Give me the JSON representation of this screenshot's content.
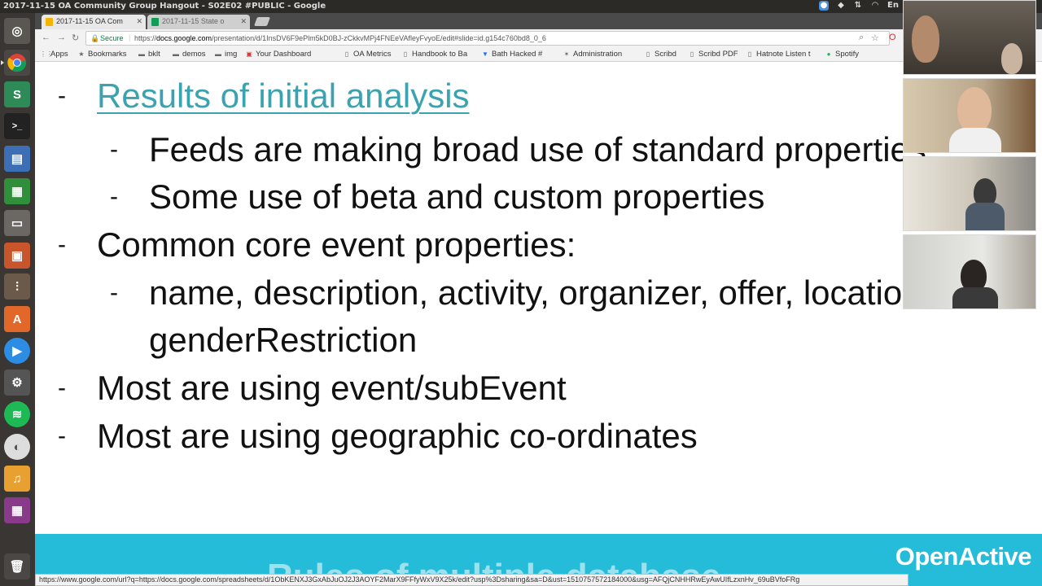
{
  "window_title": "2017-11-15 OA Community Group Hangout - S02E02 #PUBLIC - Google Slides - Goo",
  "tabs": [
    {
      "label": "2017-11-15 OA Com",
      "active": true,
      "favicon_color": "#f4b400"
    },
    {
      "label": "2017-11-15 State o",
      "active": false,
      "favicon_color": "#0f9d58"
    }
  ],
  "omnibox": {
    "secure_label": "Secure",
    "url_prefix": "https://",
    "url_host": "docs.google.com",
    "url_path": "/presentation/d/1InsDV6F9ePlm5kD0BJ-zCkkvMPj4FNEeVAfleyFvyoE/edit#slide=id.g154c760bd8_0_6"
  },
  "bookmarks": [
    {
      "label": "Apps",
      "icon": "apps-grid-icon"
    },
    {
      "label": "Bookmarks",
      "icon": "star-icon"
    },
    {
      "label": "bklt",
      "icon": "folder-icon"
    },
    {
      "label": "demos",
      "icon": "folder-icon"
    },
    {
      "label": "img",
      "icon": "folder-icon"
    },
    {
      "label": "Your Dashboard",
      "icon": "dashboard-icon"
    },
    {
      "label": "OA Metrics",
      "icon": "page-icon"
    },
    {
      "label": "Handbook to Ba",
      "icon": "page-icon"
    },
    {
      "label": "Bath Hacked #",
      "icon": "hacked-icon"
    },
    {
      "label": "Administration",
      "icon": "admin-icon"
    },
    {
      "label": "Scribd",
      "icon": "page-icon"
    },
    {
      "label": "Scribd PDF",
      "icon": "page-icon"
    },
    {
      "label": "Hatnote Listen t",
      "icon": "page-icon"
    },
    {
      "label": "Spotify",
      "icon": "spotify-icon"
    }
  ],
  "slide": {
    "heading": "Results of initial analysis",
    "bullets": [
      "Feeds are making broad use of standard properties",
      "Some use of beta and custom properties",
      "Common core event properties:",
      "name, description, activity, organizer, offer, location",
      "genderRestriction",
      "Most are using event/subEvent",
      "Most are using geographic co-ordinates"
    ],
    "dash": "-",
    "banner_logo": "OpenActive",
    "banner_ghost_text": "Rules of multiple database"
  },
  "status_url": "https://www.google.com/url?q=https://docs.google.com/spreadsheets/d/1ObKENXJ3GxAbJuOJ2J3AOYF2MarX9FFfyWxV9X25k/edit?usp%3Dsharing&sa=D&ust=1510757572184000&usg=AFQjCNHHRwEyAwUIfLzxnHv_69uBVfoFRg",
  "colors": {
    "heading_link": "#3ba3b0",
    "banner": "#24bcd8",
    "launcher_bg": "#3a3633",
    "panel_bg": "#2b2a27"
  }
}
